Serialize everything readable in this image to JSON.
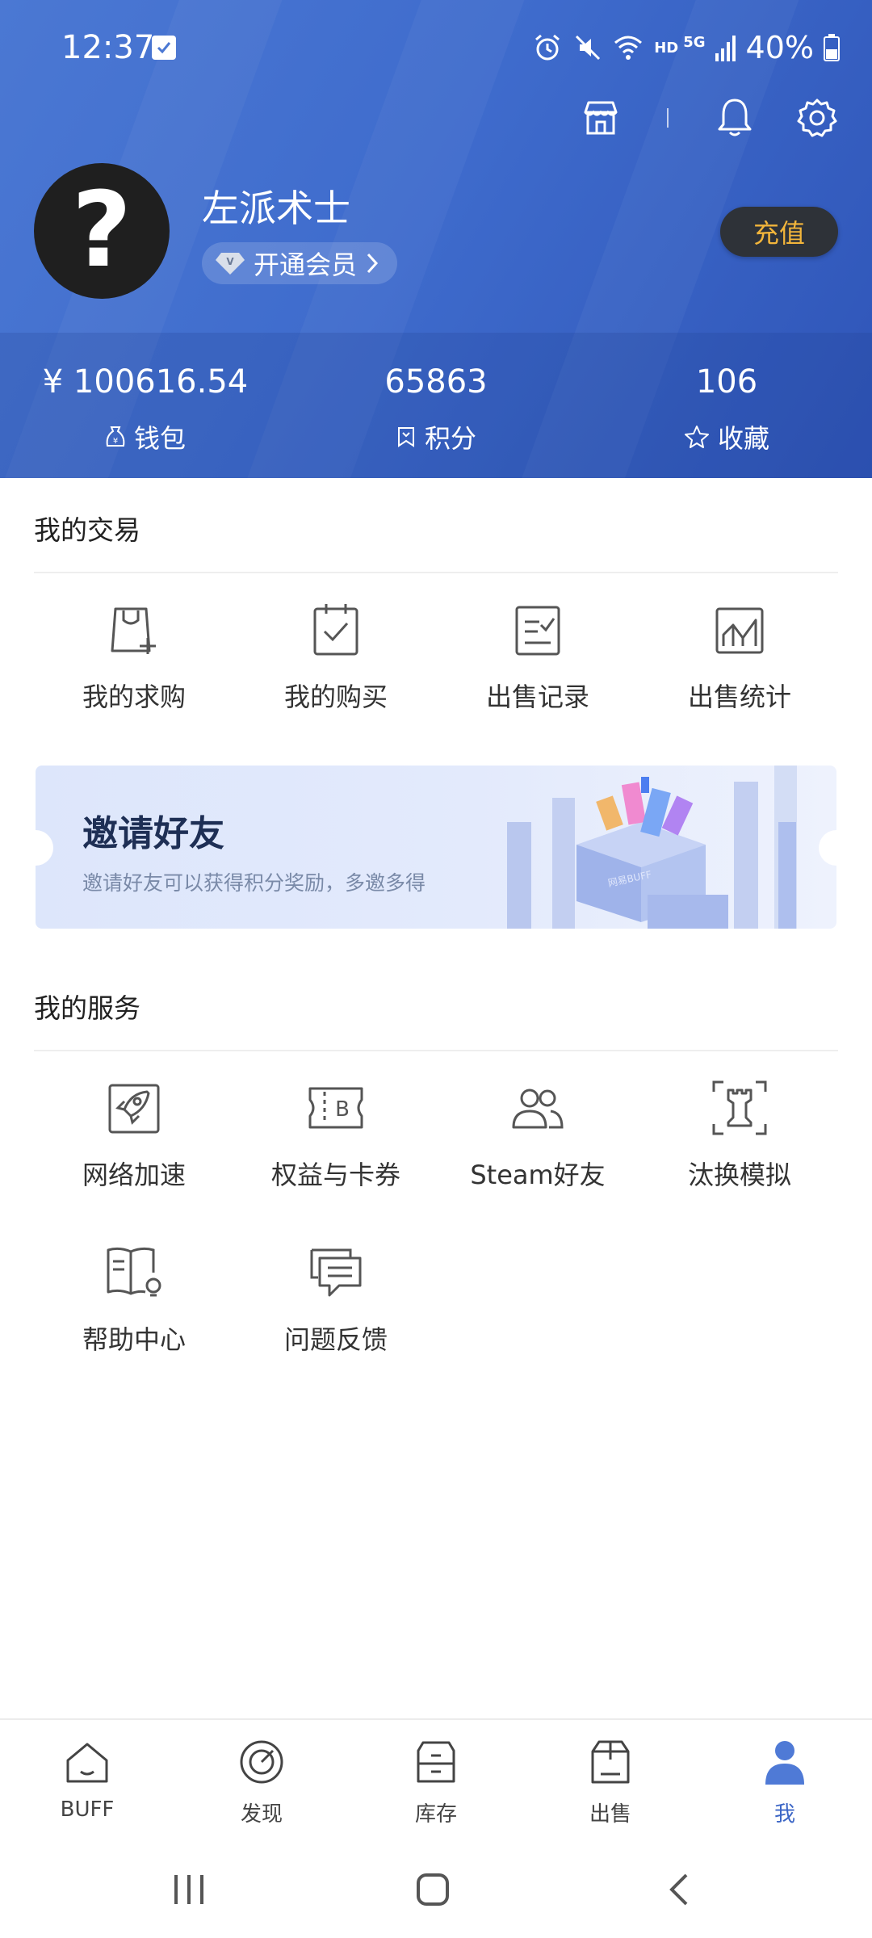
{
  "status_bar": {
    "time": "12:37",
    "network": "HD",
    "network_gen": "5G",
    "battery": "40%"
  },
  "profile": {
    "avatar_glyph": "?",
    "name": "左派术士",
    "vip_label": "开通会员",
    "recharge_label": "充值"
  },
  "stats": [
    {
      "value": "¥ 100616.54",
      "label": "钱包",
      "icon": "wallet-icon"
    },
    {
      "value": "65863",
      "label": "积分",
      "icon": "points-icon"
    },
    {
      "value": "106",
      "label": "收藏",
      "icon": "star-icon"
    }
  ],
  "trade": {
    "title": "我的交易",
    "items": [
      {
        "label": "我的求购",
        "icon": "bag-plus-icon"
      },
      {
        "label": "我的购买",
        "icon": "clipboard-check-icon"
      },
      {
        "label": "出售记录",
        "icon": "list-check-icon"
      },
      {
        "label": "出售统计",
        "icon": "chart-icon"
      }
    ]
  },
  "banner": {
    "title": "邀请好友",
    "subtitle": "邀请好友可以获得积分奖励，多邀多得",
    "box_text": "网易BUFF"
  },
  "services": {
    "title": "我的服务",
    "items": [
      {
        "label": "网络加速",
        "icon": "rocket-icon"
      },
      {
        "label": "权益与卡券",
        "icon": "ticket-icon"
      },
      {
        "label": "Steam好友",
        "icon": "friends-icon"
      },
      {
        "label": "汰换模拟",
        "icon": "rook-icon"
      },
      {
        "label": "帮助中心",
        "icon": "help-book-icon"
      },
      {
        "label": "问题反馈",
        "icon": "feedback-icon"
      }
    ]
  },
  "bottom_nav": [
    {
      "label": "BUFF",
      "icon": "home-icon"
    },
    {
      "label": "发现",
      "icon": "discover-icon"
    },
    {
      "label": "库存",
      "icon": "inventory-icon"
    },
    {
      "label": "出售",
      "icon": "sell-box-icon"
    },
    {
      "label": "我",
      "icon": "user-icon",
      "active": true
    }
  ],
  "colors": {
    "header_blue": "#3f6ccd",
    "accent": "#3c66c6",
    "recharge_text": "#f2b53b"
  }
}
